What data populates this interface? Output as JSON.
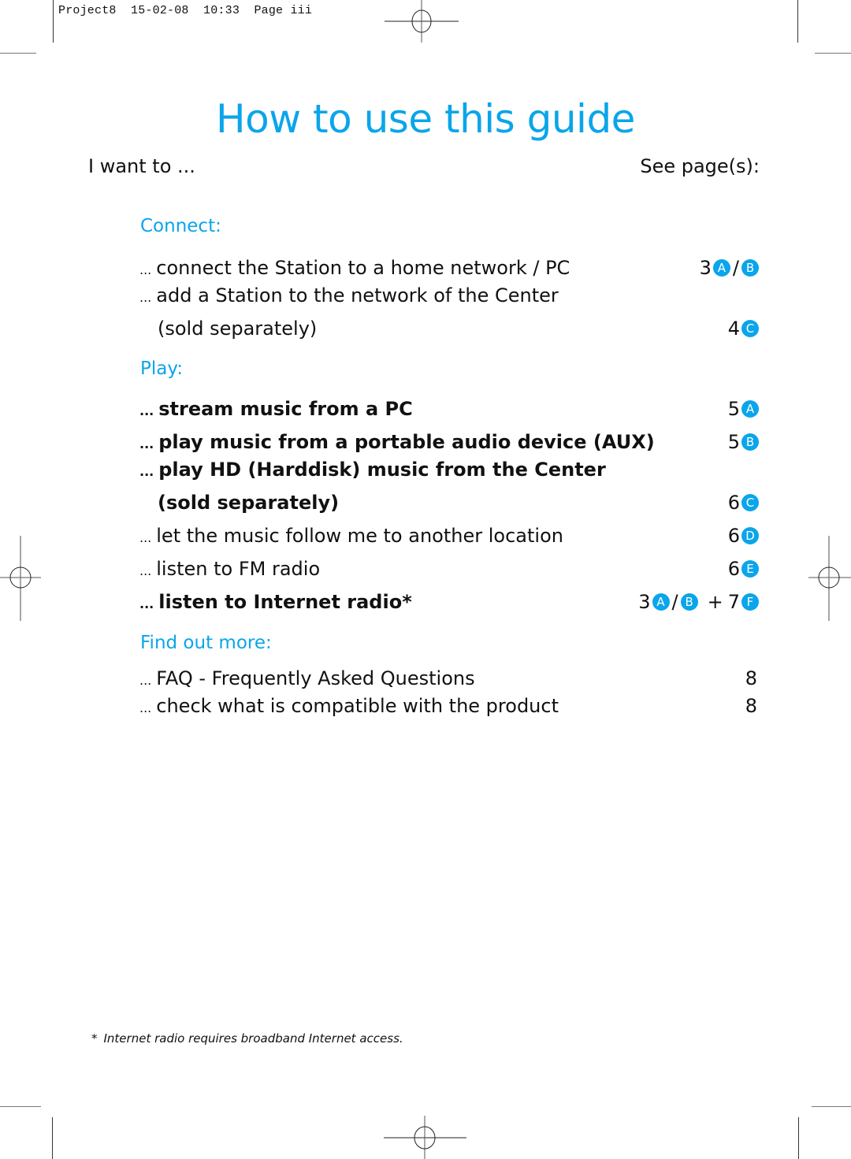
{
  "slug": {
    "text": "Project8  15-02-08  10:33  Page iii"
  },
  "colors": {
    "accent": "#0aa5ea",
    "text": "#111111"
  },
  "title": "How to use this guide",
  "header": {
    "left": "I want to ...",
    "right": "See page(s):"
  },
  "sections": {
    "connect": {
      "label": "Connect:",
      "items": [
        {
          "dots": "...",
          "text": "connect the Station to a home network / PC",
          "bold": false,
          "ref": {
            "page": "3",
            "badges": [
              "A",
              "B"
            ]
          }
        },
        {
          "dots": "...",
          "text": "add a Station to the network of the Center",
          "bold": false
        },
        {
          "text": "(sold separately)",
          "bold": false,
          "ref": {
            "page": "4",
            "badges": [
              "C"
            ]
          }
        }
      ]
    },
    "play": {
      "label": "Play:",
      "items": [
        {
          "dots": "...",
          "text": "stream music from a PC",
          "bold": true,
          "ref": {
            "page": "5",
            "badges": [
              "A"
            ]
          }
        },
        {
          "dots": "...",
          "text": "play music from a portable audio device (AUX)",
          "bold": true,
          "ref": {
            "page": "5",
            "badges": [
              "B"
            ]
          }
        },
        {
          "dots": "...",
          "text": "play HD (Harddisk) music from the Center",
          "bold": true
        },
        {
          "text": "(sold separately)",
          "bold": true,
          "ref": {
            "page": "6",
            "badges": [
              "C"
            ]
          }
        },
        {
          "dots": "...",
          "text": "let the music follow me to another location",
          "bold": false,
          "ref": {
            "page": "6",
            "badges": [
              "D"
            ]
          }
        },
        {
          "dots": "...",
          "text": "listen to FM radio",
          "bold": false,
          "ref": {
            "page": "6",
            "badges": [
              "E"
            ]
          }
        },
        {
          "dots": "...",
          "text": "listen to Internet radio*",
          "bold": true,
          "ref": {
            "page": "3",
            "badges": [
              "A",
              "B"
            ],
            "plus": "+",
            "page2": "7",
            "badges2": [
              "F"
            ]
          }
        }
      ]
    },
    "find_out_more": {
      "label": "Find out more:",
      "items": [
        {
          "dots": "...",
          "text": "FAQ - Frequently Asked Questions",
          "bold": false,
          "ref": {
            "page": "8"
          }
        },
        {
          "dots": "...",
          "text": "check what is compatible with the product",
          "bold": false,
          "ref": {
            "page": "8"
          }
        }
      ]
    }
  },
  "footnote": {
    "marker": "*",
    "text": "Internet radio requires broadband Internet access."
  }
}
